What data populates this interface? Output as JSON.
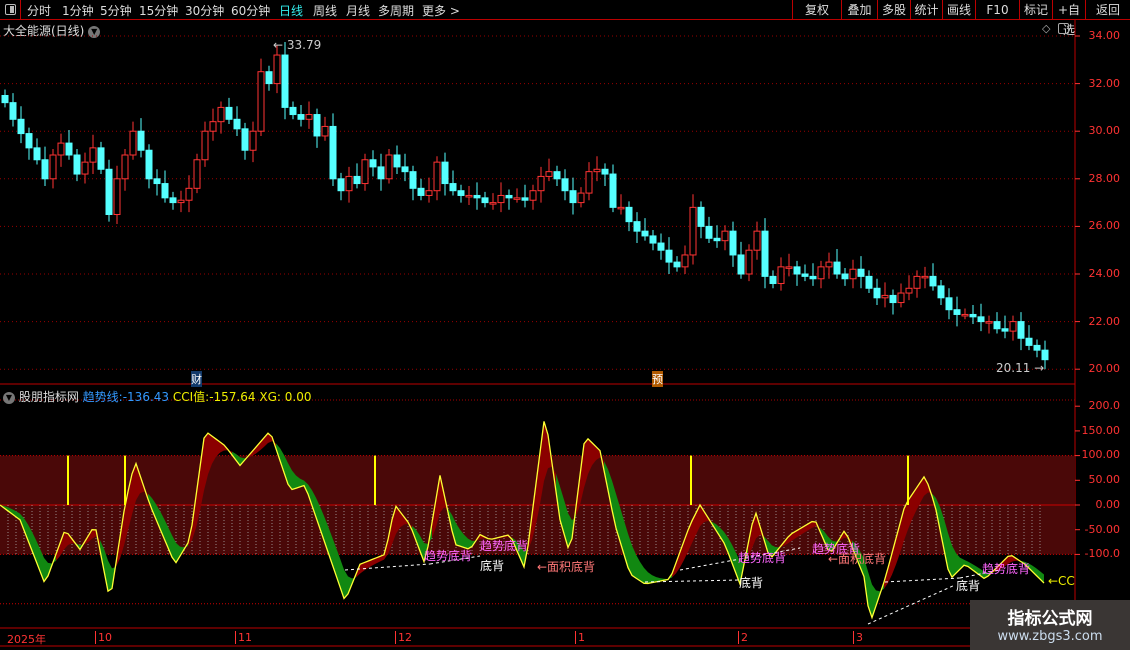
{
  "toolbar": {
    "periods": [
      "分时",
      "1分钟",
      "5分钟",
      "15分钟",
      "30分钟",
      "60分钟",
      "日线",
      "周线",
      "月线",
      "多周期",
      "更多 >"
    ],
    "active": "日线",
    "buttons": [
      "复权",
      "叠加",
      "多股",
      "统计",
      "画线",
      "F10",
      "标记",
      "+自选",
      "返回"
    ]
  },
  "main": {
    "title": "大全能源(日线)",
    "high_label": "33.79",
    "low_label": "20.11",
    "y_ticks": [
      "34.00",
      "32.00",
      "30.00",
      "28.00",
      "26.00",
      "24.00",
      "22.00",
      "20.00"
    ],
    "event_marks": [
      "财",
      "预"
    ]
  },
  "indicator": {
    "name": "股朋指标网",
    "trend_label": "趋势线:",
    "trend_value": "-136.43",
    "cci_label": "CCI值:",
    "cci_value": "-157.64",
    "xg_label": "XG:",
    "xg_value": "0.00",
    "y_ticks": [
      "200.0",
      "150.00",
      "100.00",
      "50.00",
      "0.00",
      "-50.00",
      "-100.0"
    ],
    "annotations": {
      "trend_div": "趋势底背",
      "bottom_div": "底背",
      "area_div": "←面积底背",
      "cci_tag": "←CC"
    }
  },
  "time_axis": [
    "2025年",
    "10",
    "11",
    "12",
    "1",
    "2",
    "3"
  ],
  "watermark": {
    "title": "指标公式网",
    "url": "www.zbgs3.com"
  },
  "colors": {
    "up": "#ff3333",
    "down": "#55ffff",
    "band": "#4a0808",
    "cci": "#ffff33",
    "fill_up": "#8b0000",
    "fill_down": "#118811"
  },
  "chart_data": {
    "type": "candlestick",
    "closes": [
      31.2,
      30.5,
      29.9,
      29.3,
      28.8,
      28.0,
      29.0,
      29.5,
      29.0,
      28.2,
      28.7,
      29.3,
      28.4,
      26.5,
      28.0,
      29.0,
      30.0,
      29.2,
      28.0,
      27.8,
      27.2,
      27.0,
      27.1,
      27.6,
      28.8,
      30.0,
      30.4,
      31.0,
      30.5,
      30.1,
      29.2,
      30.0,
      32.5,
      32.0,
      33.2,
      31.0,
      30.7,
      30.5,
      30.7,
      29.8,
      30.2,
      28.0,
      27.5,
      28.1,
      27.8,
      28.8,
      28.5,
      28.0,
      29.0,
      28.5,
      28.3,
      27.6,
      27.3,
      27.5,
      28.7,
      27.8,
      27.5,
      27.3,
      27.3,
      27.2,
      27.0,
      27.0,
      27.3,
      27.2,
      27.2,
      27.1,
      27.5,
      28.1,
      28.3,
      28.0,
      27.5,
      27.0,
      27.4,
      28.3,
      28.4,
      28.2,
      26.8,
      26.8,
      26.2,
      25.8,
      25.6,
      25.3,
      25.0,
      24.5,
      24.3,
      24.8,
      26.8,
      26.0,
      25.5,
      25.4,
      25.8,
      24.8,
      24.0,
      25.0,
      25.8,
      23.9,
      23.6,
      24.3,
      24.3,
      24.0,
      23.9,
      23.8,
      24.3,
      24.5,
      24.0,
      23.8,
      24.2,
      23.9,
      23.4,
      23.0,
      23.1,
      22.8,
      23.2,
      23.4,
      23.9,
      23.9,
      23.5,
      23.0,
      22.5,
      22.3,
      22.3,
      22.2,
      22.0,
      22.0,
      21.7,
      21.6,
      22.0,
      21.3,
      21.0,
      20.8,
      20.4
    ],
    "cci_points": [
      [
        0,
        0
      ],
      [
        20,
        -30
      ],
      [
        45,
        -160
      ],
      [
        65,
        -50
      ],
      [
        80,
        -90
      ],
      [
        95,
        -40
      ],
      [
        110,
        -195
      ],
      [
        125,
        0
      ],
      [
        135,
        90
      ],
      [
        150,
        0
      ],
      [
        175,
        -120
      ],
      [
        190,
        -70
      ],
      [
        205,
        150
      ],
      [
        225,
        120
      ],
      [
        240,
        80
      ],
      [
        270,
        150
      ],
      [
        290,
        30
      ],
      [
        305,
        40
      ],
      [
        345,
        -195
      ],
      [
        360,
        -120
      ],
      [
        385,
        -100
      ],
      [
        395,
        0
      ],
      [
        410,
        -40
      ],
      [
        425,
        -120
      ],
      [
        440,
        60
      ],
      [
        455,
        -80
      ],
      [
        470,
        -90
      ],
      [
        480,
        -60
      ],
      [
        490,
        -70
      ],
      [
        510,
        -60
      ],
      [
        525,
        -130
      ],
      [
        545,
        185
      ],
      [
        560,
        -30
      ],
      [
        570,
        -100
      ],
      [
        585,
        140
      ],
      [
        600,
        110
      ],
      [
        615,
        -40
      ],
      [
        630,
        -140
      ],
      [
        645,
        -160
      ],
      [
        670,
        -150
      ],
      [
        690,
        -40
      ],
      [
        700,
        0
      ],
      [
        725,
        -80
      ],
      [
        740,
        -160
      ],
      [
        755,
        -10
      ],
      [
        770,
        -110
      ],
      [
        790,
        -60
      ],
      [
        815,
        -30
      ],
      [
        830,
        -100
      ],
      [
        845,
        -50
      ],
      [
        865,
        -150
      ],
      [
        870,
        -240
      ],
      [
        885,
        -150
      ],
      [
        905,
        0
      ],
      [
        925,
        60
      ],
      [
        935,
        0
      ],
      [
        950,
        -150
      ],
      [
        965,
        -120
      ],
      [
        985,
        -150
      ],
      [
        1010,
        -100
      ],
      [
        1025,
        -120
      ],
      [
        1045,
        -160
      ]
    ]
  }
}
